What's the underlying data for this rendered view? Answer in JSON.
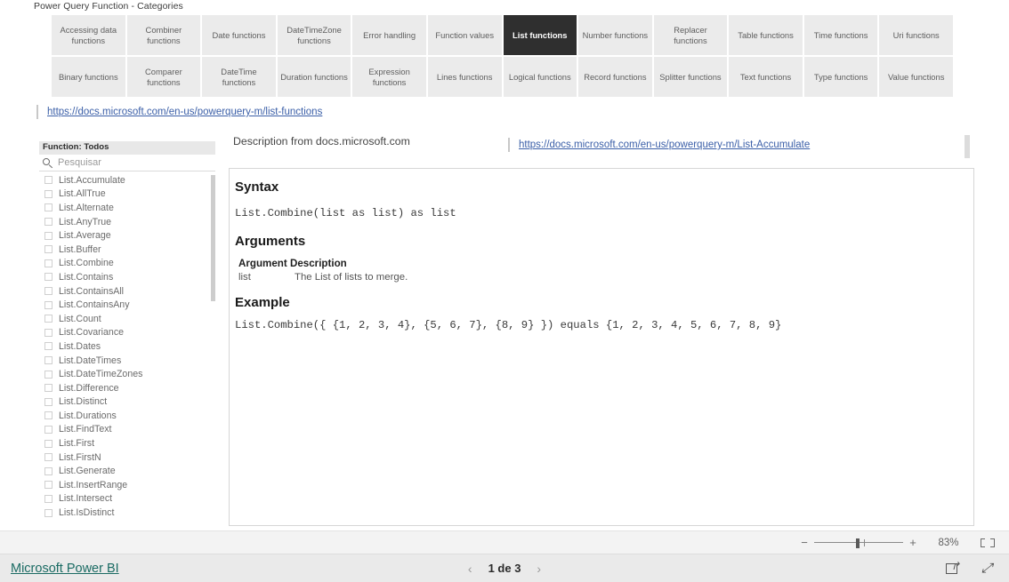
{
  "report": {
    "title": "Power Query Function - Categories",
    "categories": [
      "Accessing data functions",
      "Combiner functions",
      "Date functions",
      "DateTimeZone functions",
      "Error handling",
      "Function values",
      "List functions",
      "Number functions",
      "Replacer functions",
      "Table functions",
      "Time functions",
      "Uri functions",
      "Binary functions",
      "Comparer functions",
      "DateTime functions",
      "Duration functions",
      "Expression functions",
      "Lines functions",
      "Logical functions",
      "Record functions",
      "Splitter functions",
      "Text functions",
      "Type functions",
      "Value functions"
    ],
    "selected_category": "List functions",
    "category_link": "https://docs.microsoft.com/en-us/powerquery-m/list-functions"
  },
  "slicer": {
    "header": "Function: Todos",
    "search_placeholder": "Pesquisar",
    "items": [
      "List.Accumulate",
      "List.AllTrue",
      "List.Alternate",
      "List.AnyTrue",
      "List.Average",
      "List.Buffer",
      "List.Combine",
      "List.Contains",
      "List.ContainsAll",
      "List.ContainsAny",
      "List.Count",
      "List.Covariance",
      "List.Dates",
      "List.DateTimes",
      "List.DateTimeZones",
      "List.Difference",
      "List.Distinct",
      "List.Durations",
      "List.FindText",
      "List.First",
      "List.FirstN",
      "List.Generate",
      "List.InsertRange",
      "List.Intersect",
      "List.IsDistinct"
    ]
  },
  "description": {
    "label": "Description from docs.microsoft.com",
    "link": "https://docs.microsoft.com/en-us/powerquery-m/List-Accumulate"
  },
  "doc": {
    "syntax_heading": "Syntax",
    "syntax_code": "List.Combine(list as list) as list",
    "arguments_heading": "Arguments",
    "arguments_table_heading": "Argument Description",
    "argument_name": "list",
    "argument_description": "The List of lists to merge.",
    "example_heading": "Example",
    "example_code": "List.Combine({ {1, 2, 3, 4}, {5, 6, 7}, {8, 9} }) equals {1, 2, 3, 4, 5, 6, 7, 8, 9}"
  },
  "zoombar": {
    "minus": "−",
    "plus": "+",
    "percent": "83%",
    "fit_icon": "fit-to-page-icon"
  },
  "statusbar": {
    "brand": "Microsoft Power BI",
    "prev": "‹",
    "page_text": "1 de 3",
    "next": "›",
    "share_icon": "share-icon",
    "fullscreen_icon": "fullscreen-icon"
  },
  "colors": {
    "tile_bg": "#ebebeb",
    "tile_selected_bg": "#2f2f2f",
    "link": "#3b5fa8",
    "brand_link": "#1a6b63"
  }
}
